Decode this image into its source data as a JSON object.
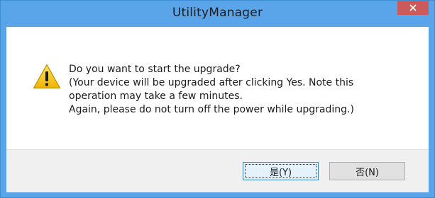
{
  "window": {
    "title": "UtilityManager"
  },
  "message": {
    "icon": "warning-icon",
    "lines": [
      "Do you want to start the upgrade?",
      "(Your device will be upgraded after clicking Yes. Note this",
      "operation may take a few minutes.",
      "Again, please do not turn off the power while upgrading.)"
    ]
  },
  "buttons": {
    "yes_label": "是(Y)",
    "no_label": "否(N)"
  },
  "colors": {
    "titlebar": "#5aa5ea",
    "close_button": "#cd5a5a",
    "button_bar": "#f0f0f0"
  }
}
